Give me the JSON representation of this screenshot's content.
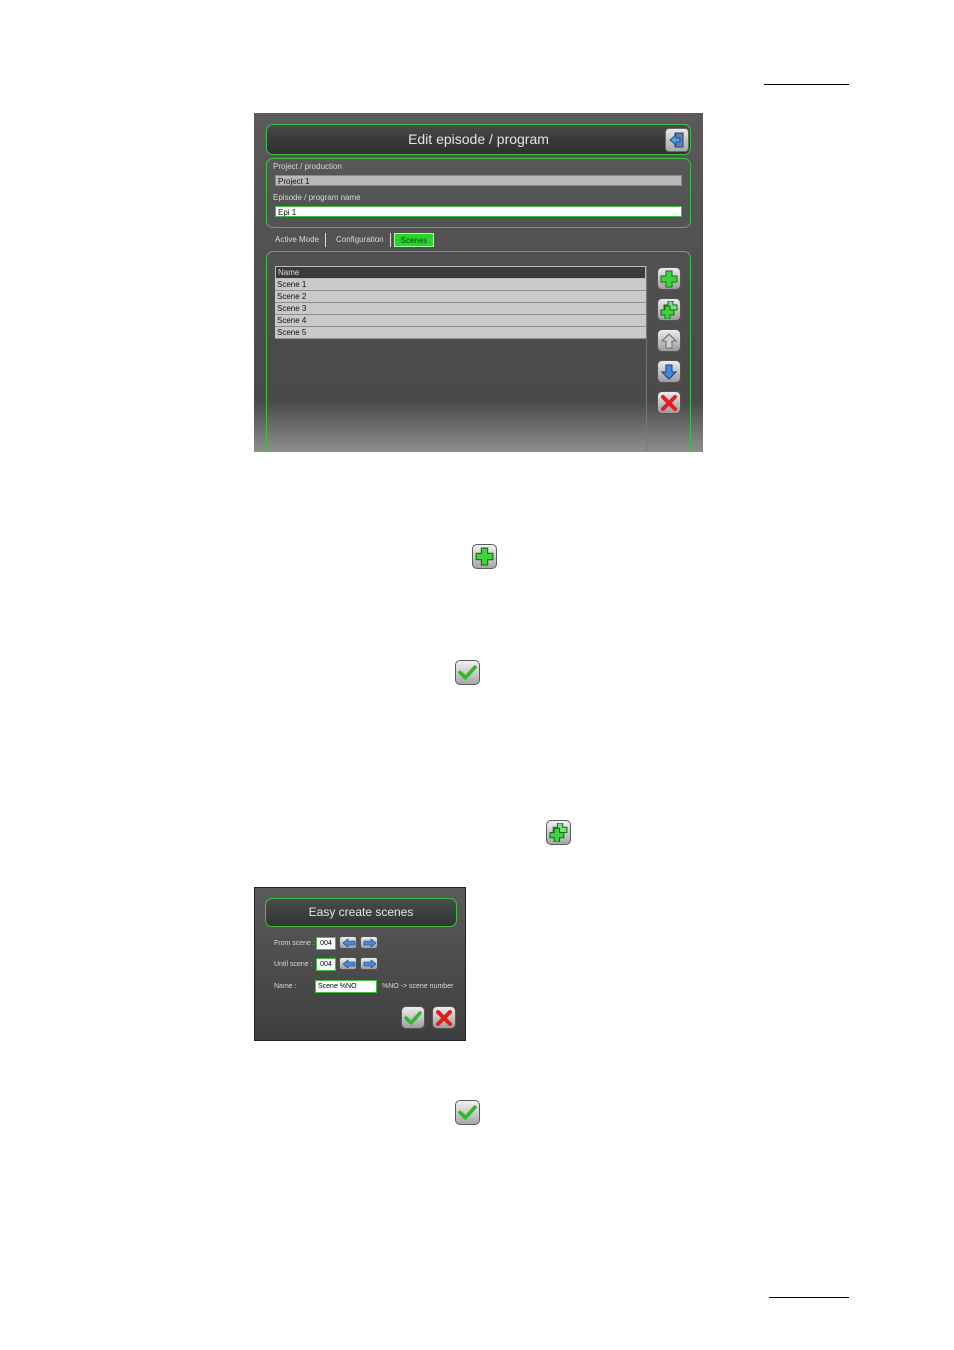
{
  "editor": {
    "title": "Edit episode / program",
    "project_label": "Project / production",
    "project_value": "Project 1",
    "episode_label": "Episode / program name",
    "episode_value": "Epi 1",
    "tabs": [
      "Active Mode",
      "Configuration",
      "Scenes"
    ],
    "active_tab": "Scenes",
    "table_header": "Name",
    "scenes": [
      "Scene 1",
      "Scene 2",
      "Scene 3",
      "Scene 4",
      "Scene 5"
    ],
    "side_buttons": [
      "add-icon",
      "add-multiple-icon",
      "move-up-icon",
      "move-down-icon",
      "delete-icon"
    ]
  },
  "inline_icons": [
    "add-icon",
    "confirm-icon",
    "add-multiple-icon",
    "confirm-icon"
  ],
  "easy_create": {
    "title": "Easy create scenes",
    "from_label": "From scene :",
    "from_value": "004",
    "until_label": "Until scene :",
    "until_value": "004",
    "name_label": "Name :",
    "name_value": "Scene %NO",
    "name_hint": "%NO -> scene number"
  },
  "colors": {
    "accent_green": "#3fbf3f",
    "tab_active": "#2bd22b",
    "panel_bg": "#4e4e4e"
  }
}
